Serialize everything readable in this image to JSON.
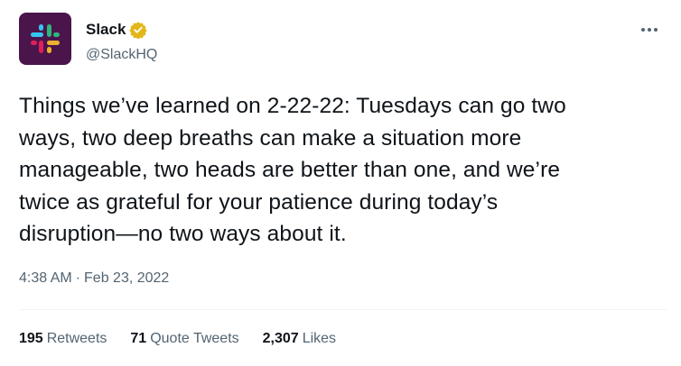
{
  "account": {
    "display_name": "Slack",
    "handle": "@SlackHQ",
    "verified_badge_color": "#e2b719",
    "avatar_bg": "#4a154b"
  },
  "tweet": {
    "text_lines": [
      "Things we’ve learned on 2-22-22: Tuesdays can go two",
      "ways, two deep breaths can make a situation more",
      "manageable, two heads are better than one, and we’re",
      "twice as grateful for your patience during today’s",
      "disruption—no two ways about it."
    ],
    "time": "4:38 AM",
    "separator": "·",
    "date": "Feb 23, 2022"
  },
  "stats": {
    "retweets": {
      "count": "195",
      "label": "Retweets"
    },
    "quote_tweets": {
      "count": "71",
      "label": "Quote Tweets"
    },
    "likes": {
      "count": "2,307",
      "label": "Likes"
    }
  },
  "icons": {
    "more": "more-horizontal-icon",
    "verified": "verified-badge-icon",
    "avatar": "slack-logo-icon"
  }
}
